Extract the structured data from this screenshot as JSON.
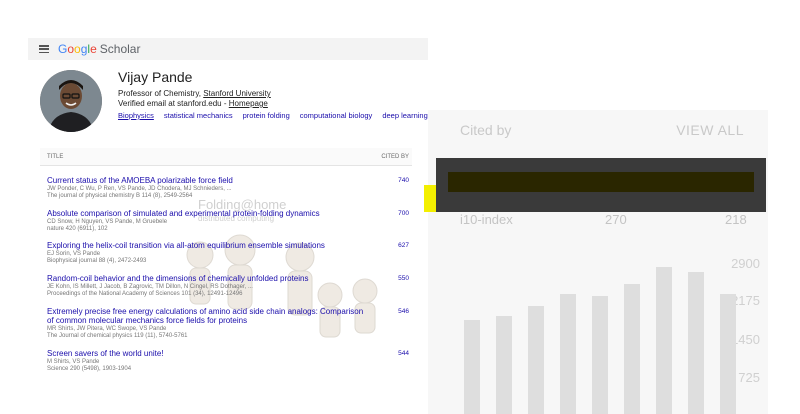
{
  "header": {
    "logo_google": "Google",
    "logo_scholar": "Scholar"
  },
  "profile": {
    "name": "Vijay Pande",
    "affiliation_prefix": "Professor of Chemistry, ",
    "affiliation_link": "Stanford University",
    "email_prefix": "Verified email at stanford.edu - ",
    "email_link": "Homepage",
    "interests": [
      "Biophysics",
      "statistical mechanics",
      "protein folding",
      "computational biology",
      "deep learning"
    ]
  },
  "table": {
    "col_title": "TITLE",
    "col_cited": "CITED BY",
    "rows": [
      {
        "title": "Current status of the AMOEBA polarizable force field",
        "authors": "JW Ponder, C Wu, P Ren, VS Pande, JD Chodera, MJ Schnieders, ...",
        "venue": "The journal of physical chemistry B 114 (8), 2549-2564",
        "cited": "740"
      },
      {
        "title": "Absolute comparison of simulated and experimental protein-folding dynamics",
        "authors": "CD Snow, H Nguyen, VS Pande, M Gruebele",
        "venue": "nature 420 (6911), 102",
        "cited": "700"
      },
      {
        "title": "Exploring the helix-coil transition via all-atom equilibrium ensemble simulations",
        "authors": "EJ Sorin, VS Pande",
        "venue": "Biophysical journal 88 (4), 2472-2493",
        "cited": "627"
      },
      {
        "title": "Random-coil behavior and the dimensions of chemically unfolded proteins",
        "authors": "JE Kohn, IS Millett, J Jacob, B Zagrovic, TM Dillon, N Cingel, RS Dothager, ...",
        "venue": "Proceedings of the National Academy of Sciences 101 (34), 12491-12496",
        "cited": "550"
      },
      {
        "title": "Extremely precise free energy calculations of amino acid side chain analogs: Comparison of common molecular mechanics force fields for proteins",
        "authors": "MR Shirts, JW Pitera, WC Swope, VS Pande",
        "venue": "The Journal of chemical physics 119 (11), 5740-5761",
        "cited": "546"
      },
      {
        "title": "Screen savers of the world unite!",
        "authors": "M Shirts, VS Pande",
        "venue": "Science 290 (5498), 1903-1904",
        "cited": "544"
      }
    ]
  },
  "overlay": {
    "folding_title": "Folding@home",
    "folding_sub": "distributed computing"
  },
  "cited_panel": {
    "title": "Cited by",
    "view_all": "VIEW ALL",
    "row_label": "i10-index",
    "row_val1": "270",
    "row_val2": "218",
    "ticks": [
      "2900",
      "2175",
      "1450",
      "725"
    ]
  },
  "colors": {
    "link": "#1a0dab",
    "highlight": "#f3ef00",
    "dark_overlay": "#3a3a3a"
  }
}
